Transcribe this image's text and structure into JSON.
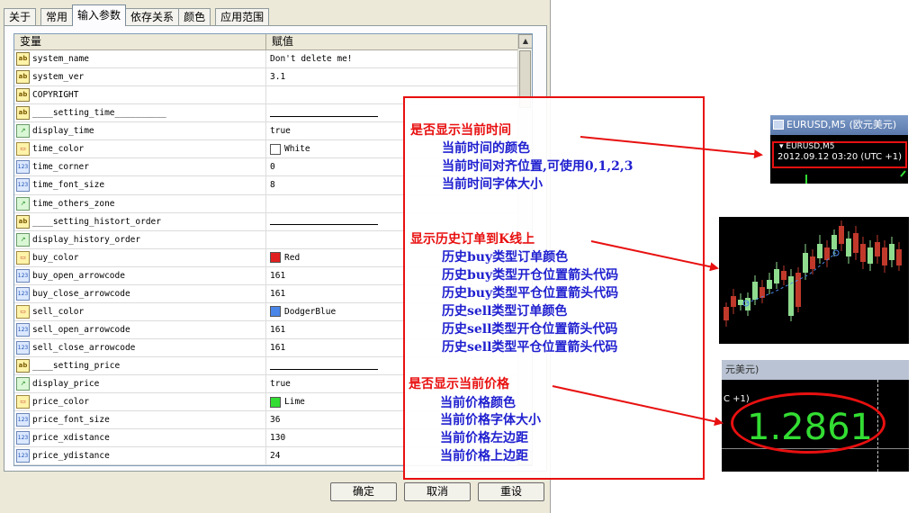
{
  "dialog": {
    "tabs": [
      {
        "label": "关于"
      },
      {
        "label": "常用"
      },
      {
        "label": "输入参数"
      },
      {
        "label": "依存关系"
      },
      {
        "label": "颜色"
      },
      {
        "label": "应用范围"
      }
    ],
    "active_tab": "输入参数",
    "grid": {
      "col_variable": "变量",
      "col_value": "赋值",
      "rows": [
        {
          "icon": "ab",
          "name": "system_name",
          "value": "Don't delete me!"
        },
        {
          "icon": "ab",
          "name": "system_ver",
          "value": "3.1"
        },
        {
          "icon": "ab",
          "name": "COPYRIGHT",
          "value": ""
        },
        {
          "icon": "ab",
          "name": "____setting_time__________",
          "value": ""
        },
        {
          "icon": "bool",
          "name": "display_time",
          "value": "true"
        },
        {
          "icon": "color",
          "name": "time_color",
          "value": "White",
          "swatch": "#ffffff"
        },
        {
          "icon": "num",
          "name": "time_corner",
          "value": "0"
        },
        {
          "icon": "num",
          "name": "time_font_size",
          "value": "8"
        },
        {
          "icon": "bool",
          "name": "time_others_zone",
          "value": ""
        },
        {
          "icon": "ab",
          "name": "____setting_histort_order",
          "value": ""
        },
        {
          "icon": "bool",
          "name": "display_history_order",
          "value": ""
        },
        {
          "icon": "color",
          "name": "buy_color",
          "value": "Red",
          "swatch": "#e02020"
        },
        {
          "icon": "num",
          "name": "buy_open_arrowcode",
          "value": "161"
        },
        {
          "icon": "num",
          "name": "buy_close_arrowcode",
          "value": "161"
        },
        {
          "icon": "color",
          "name": "sell_color",
          "value": "DodgerBlue",
          "swatch": "#4a86e8"
        },
        {
          "icon": "num",
          "name": "sell_open_arrowcode",
          "value": "161"
        },
        {
          "icon": "num",
          "name": "sell_close_arrowcode",
          "value": "161"
        },
        {
          "icon": "ab",
          "name": "____setting_price",
          "value": ""
        },
        {
          "icon": "bool",
          "name": "display_price",
          "value": "true"
        },
        {
          "icon": "color",
          "name": "price_color",
          "value": "Lime",
          "swatch": "#33dd33"
        },
        {
          "icon": "num",
          "name": "price_font_size",
          "value": "36"
        },
        {
          "icon": "num",
          "name": "price_xdistance",
          "value": "130"
        },
        {
          "icon": "num",
          "name": "price_ydistance",
          "value": "24"
        }
      ]
    },
    "buttons": {
      "ok": "确定",
      "cancel": "取消",
      "reset": "重设"
    }
  },
  "annotations": {
    "time_head": "是否显示当前时间",
    "time_color": "当前时间的颜色",
    "time_corner": "当前时间对齐位置,可使用0,1,2,3",
    "time_font": "当前时间字体大小",
    "history_head": "显示历史订单到K线上",
    "buy_color": "历史buy类型订单颜色",
    "buy_open": "历史buy类型开仓位置箭头代码",
    "buy_close": "历史buy类型平仓位置箭头代码",
    "sell_color": "历史sell类型订单颜色",
    "sell_open": "历史sell类型开仓位置箭头代码",
    "sell_close": "历史sell类型平仓位置箭头代码",
    "price_head": "是否显示当前价格",
    "price_color": "当前价格颜色",
    "price_font": "当前价格字体大小",
    "price_x": "当前价格左边距",
    "price_y": "当前价格上边距"
  },
  "shots": {
    "chart_title": "EURUSD,M5 (欧元美元)",
    "symbol": "▾ EURUSD,M5",
    "datetime": "2012.09.12 03:20 (UTC +1)",
    "price_bar": "元美元)",
    "utc": "C +1)",
    "price": "1.2861"
  },
  "colors": {
    "annotation_red": "#e81010",
    "annotation_blue": "#2020d0",
    "price_green": "#33dd33"
  }
}
